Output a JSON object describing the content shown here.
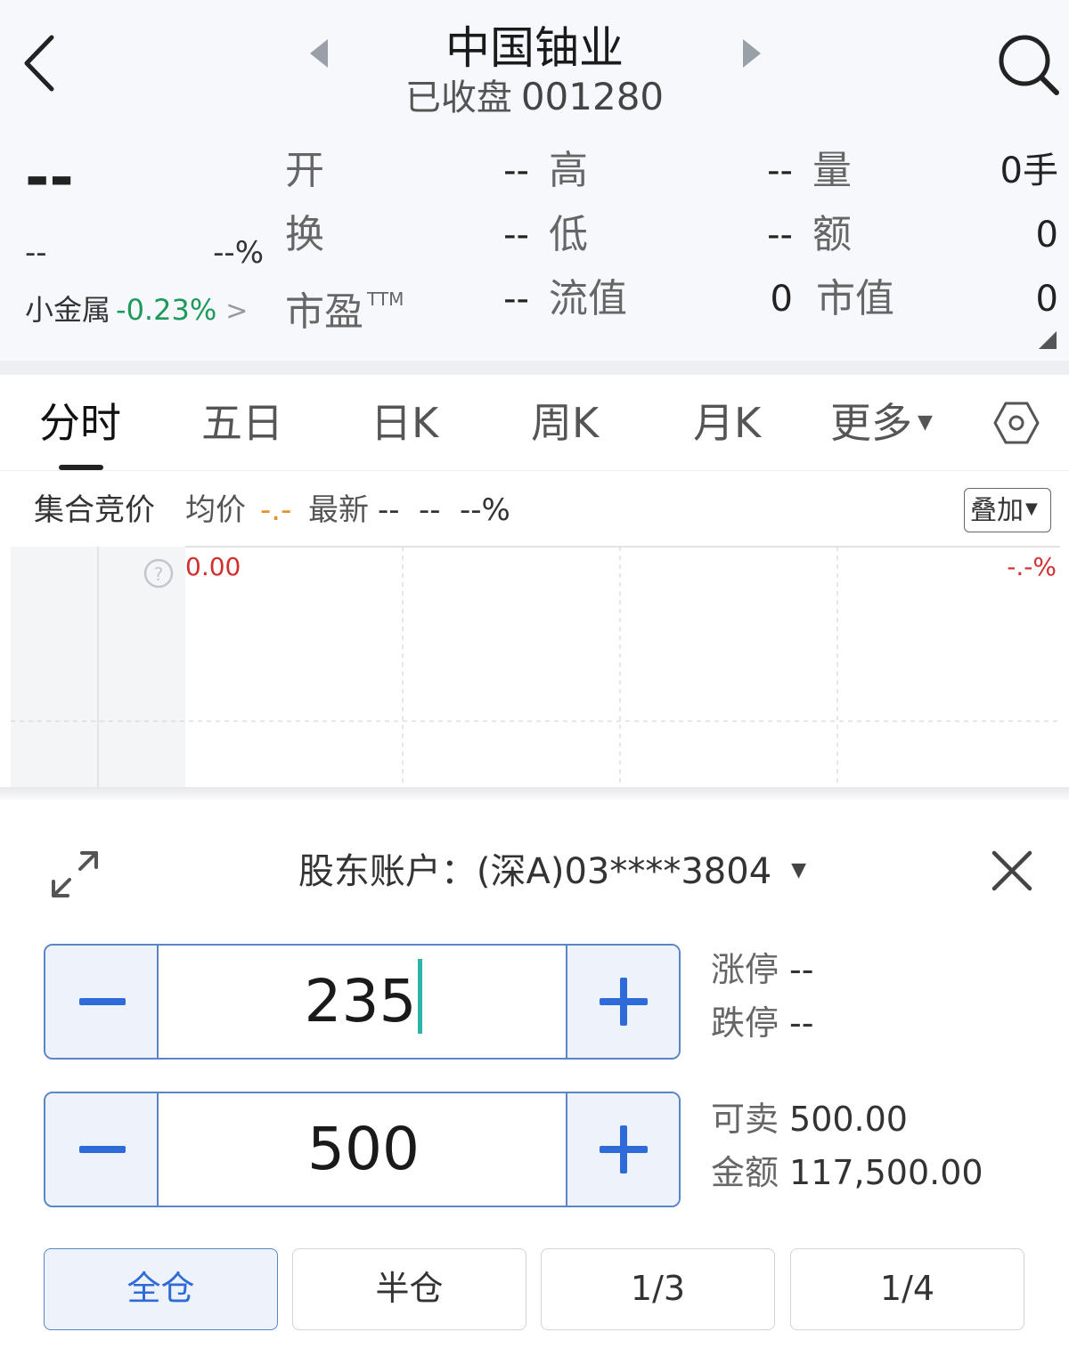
{
  "header": {
    "title": "中国铀业",
    "status": "已收盘",
    "code": "001280"
  },
  "quote": {
    "price": "--",
    "change": "--",
    "change_pct": "--%",
    "sector_name": "小金属",
    "sector_pct": "-0.23%",
    "sector_arrow": ">",
    "stats": [
      {
        "label": "开",
        "value": "--"
      },
      {
        "label": "高",
        "value": "--"
      },
      {
        "label": "量",
        "value": "0手"
      },
      {
        "label": "换",
        "value": "--"
      },
      {
        "label": "低",
        "value": "--"
      },
      {
        "label": "额",
        "value": "0"
      },
      {
        "label": "市盈",
        "sup": "TTM",
        "value": "--"
      },
      {
        "label": "流值",
        "value": "0"
      },
      {
        "label": "市值",
        "value": "0"
      }
    ]
  },
  "tabs": [
    "分时",
    "五日",
    "日K",
    "周K",
    "月K",
    "更多"
  ],
  "chart_info": {
    "auction_label": "集合竞价",
    "avg_label": "均价",
    "avg_value": "-.-",
    "latest_label": "最新",
    "latest_price": "--",
    "latest_change": "--",
    "latest_pct": "--%",
    "overlay_label": "叠加",
    "price_label": "0.00",
    "pct_label": "-.-%"
  },
  "trade": {
    "account_label": "股东账户：",
    "account_value": "(深A)03****3804",
    "price_input": "235",
    "qty_input": "500",
    "limit_up_label": "涨停",
    "limit_up_value": "--",
    "limit_down_label": "跌停",
    "limit_down_value": "--",
    "sellable_label": "可卖",
    "sellable_value": "500.00",
    "amount_label": "金额",
    "amount_value": "117,500.00",
    "ratio_buttons": [
      "全仓",
      "半仓",
      "1/3",
      "1/4"
    ]
  },
  "colors": {
    "accent": "#2f6ad9",
    "down_green": "#1d9a5a",
    "up_red": "#d0302f",
    "avg_orange": "#e8902a"
  }
}
